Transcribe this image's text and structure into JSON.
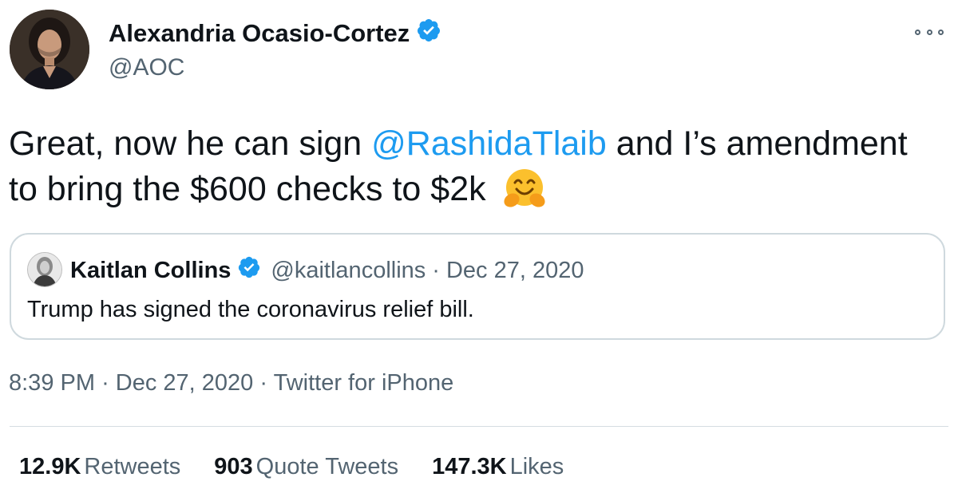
{
  "tweet": {
    "author": {
      "name": "Alexandria Ocasio-Cortez",
      "handle": "@AOC",
      "verified": true
    },
    "text": {
      "before_mention": "Great, now he can sign ",
      "mention": "@RashidaTlaib",
      "after_mention": " and I’s amendment to bring the $600 checks to $2k",
      "emoji": "hugging-face-emoji"
    },
    "quoted": {
      "name": "Kaitlan Collins",
      "handle": "@kaitlancollins",
      "separator": "·",
      "date": "Dec 27, 2020",
      "verified": true,
      "text": "Trump has signed the coronavirus relief bill."
    },
    "meta": {
      "time": "8:39 PM",
      "separator": "·",
      "date": "Dec 27, 2020",
      "source": "Twitter for iPhone"
    },
    "stats": {
      "retweets_count": "12.9K",
      "retweets_label": "Retweets",
      "quote_count": "903",
      "quote_label": "Quote Tweets",
      "likes_count": "147.3K",
      "likes_label": "Likes"
    }
  },
  "colors": {
    "link": "#1d9bf0",
    "secondary_text": "#536471",
    "border": "#cfd9de",
    "verified": "#1d9bf0"
  },
  "icons": {
    "more": "more-horizontal-icon",
    "verified": "verified-badge-icon"
  }
}
